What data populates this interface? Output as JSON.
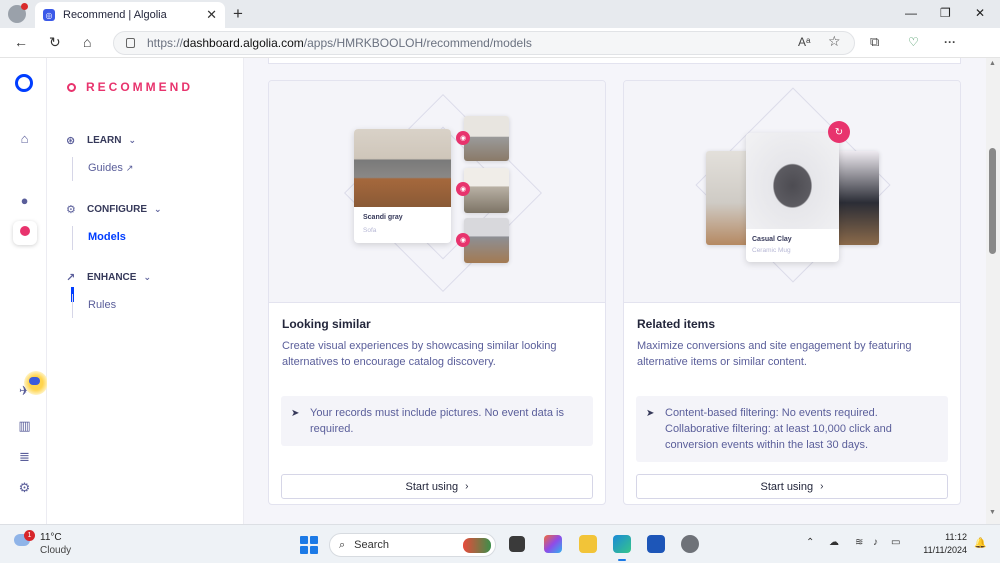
{
  "browser": {
    "tab_title": "Recommend | Algolia",
    "new_tab_symbol": "+",
    "close_symbol": "✕",
    "url_prefix": "https://",
    "url_host": "dashboard.algolia.com",
    "url_path": "/apps/HMRKBOOLOH/recommend/models",
    "window_controls": [
      "—",
      "❐",
      "✕"
    ]
  },
  "icons": {
    "back": "back-arrow-icon",
    "refresh": "refresh-icon",
    "home": "home-icon",
    "lock": "lock-icon",
    "read_aloud": "read-aloud-icon",
    "favorite": "star-icon",
    "extensions": "puzzle-icon",
    "menu": "ellipsis-icon",
    "copilot": "copilot-icon"
  },
  "app_sidebar": {
    "items": [
      "algolia-logo",
      "home",
      "search-product",
      "recommend-product",
      "onboarding",
      "analytics",
      "data-sources",
      "settings"
    ]
  },
  "nav": {
    "brand": "RECOMMEND",
    "sections": [
      {
        "label": "LEARN",
        "items": [
          "Guides"
        ]
      },
      {
        "label": "CONFIGURE",
        "items": [
          "Models"
        ]
      },
      {
        "label": "ENHANCE",
        "items": [
          "Rules"
        ]
      }
    ],
    "active_item": "Models"
  },
  "cards": [
    {
      "title": "Looking similar",
      "description": "Create visual experiences by showcasing similar looking alternatives to encourage catalog discovery.",
      "requirement": "Your records must include pictures. No event data is required.",
      "button": "Start using",
      "product_name": "Scandi gray",
      "product_category": "Sofa"
    },
    {
      "title": "Related items",
      "description": "Maximize conversions and site engagement by featuring alternative items or similar content.",
      "requirement": "Content-based filtering: No events required. Collaborative filtering: at least 10,000 click and conversion events within the last 30 days.",
      "button": "Start using",
      "product_name": "Casual Clay",
      "product_category": "Ceramic Mug"
    }
  ],
  "taskbar": {
    "weather_temp": "11°C",
    "weather_condition": "Cloudy",
    "weather_badge": "1",
    "search_label": "Search",
    "time": "11:12",
    "date": "11/11/2024"
  },
  "colors": {
    "algolia_blue": "#003dff",
    "recommend_pink": "#e8336d",
    "text_primary": "#23263b",
    "text_secondary": "#5a5e9a",
    "background": "#f5f5fa"
  }
}
